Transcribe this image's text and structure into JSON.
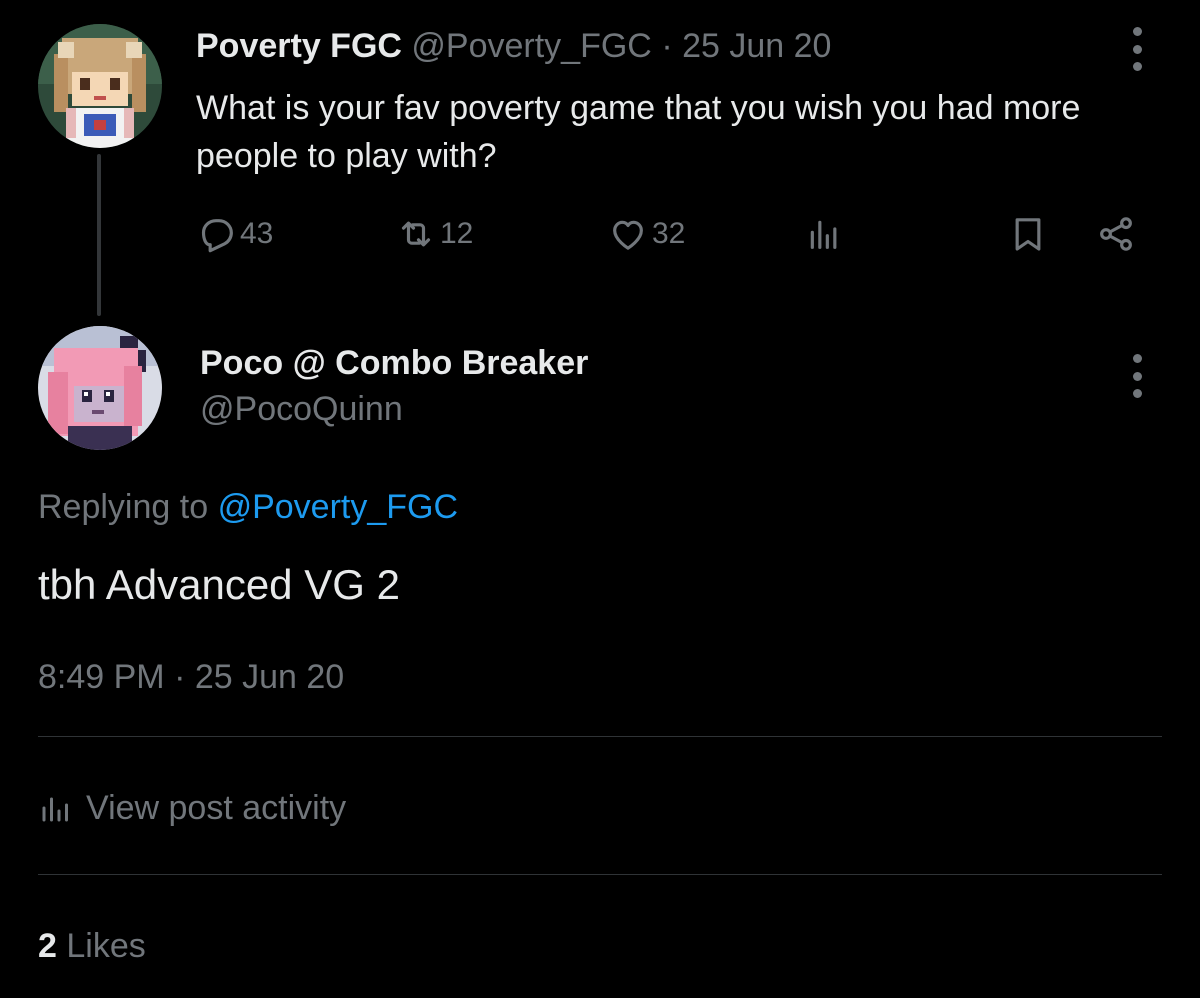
{
  "parent_tweet": {
    "display_name": "Poverty FGC",
    "handle": "@Poverty_FGC",
    "separator": "·",
    "date": "25 Jun 20",
    "text": "What is your fav poverty game that you wish you had more people to play with?",
    "actions": {
      "replies": "43",
      "retweets": "12",
      "likes": "32"
    }
  },
  "reply_tweet": {
    "display_name": "Poco @ Combo Breaker",
    "handle": "@PocoQuinn",
    "replying_label": "Replying to",
    "replying_mention": "@Poverty_FGC",
    "text": "tbh Advanced VG 2",
    "timestamp": "8:49 PM · 25 Jun 20"
  },
  "activity": {
    "label": "View post activity"
  },
  "likes": {
    "count": "2",
    "label": "Likes"
  },
  "colors": {
    "background": "#000000",
    "text_primary": "#e7e9ea",
    "text_muted": "#71767b",
    "link": "#1d9bf0",
    "divider": "#2f3336"
  },
  "icons": [
    "more-icon",
    "reply-icon",
    "retweet-icon",
    "like-icon",
    "views-icon",
    "bookmark-icon",
    "share-icon",
    "activity-icon"
  ]
}
